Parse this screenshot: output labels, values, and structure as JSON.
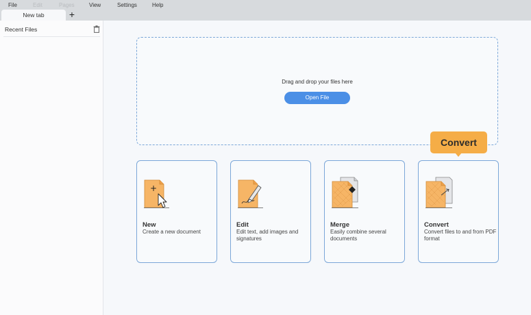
{
  "menu": {
    "items": [
      {
        "label": "File",
        "enabled": true
      },
      {
        "label": "Edit",
        "enabled": false
      },
      {
        "label": "Pages",
        "enabled": false
      },
      {
        "label": "View",
        "enabled": true
      },
      {
        "label": "Settings",
        "enabled": true
      },
      {
        "label": "Help",
        "enabled": true
      }
    ]
  },
  "tabs": {
    "active_label": "New tab",
    "add_label": "+"
  },
  "sidebar": {
    "title": "Recent Files",
    "trash_icon": "trash-icon"
  },
  "dropzone": {
    "hint": "Drag and drop your files here",
    "open_button": "Open File"
  },
  "cards": [
    {
      "title": "New",
      "description": "Create a new document",
      "icon": "new-document-icon"
    },
    {
      "title": "Edit",
      "description": "Edit text, add images and signatures",
      "icon": "edit-document-icon"
    },
    {
      "title": "Merge",
      "description": "Easily combine several documents",
      "icon": "merge-documents-icon"
    },
    {
      "title": "Convert",
      "description": "Convert files to and from PDF format",
      "icon": "convert-document-icon"
    }
  ],
  "tooltip": {
    "label": "Convert"
  },
  "colors": {
    "accent": "#4b8fe6",
    "card_border": "#7aa6d8",
    "tooltip_bg": "#f5ad47",
    "doc_orange": "#f6b566"
  }
}
